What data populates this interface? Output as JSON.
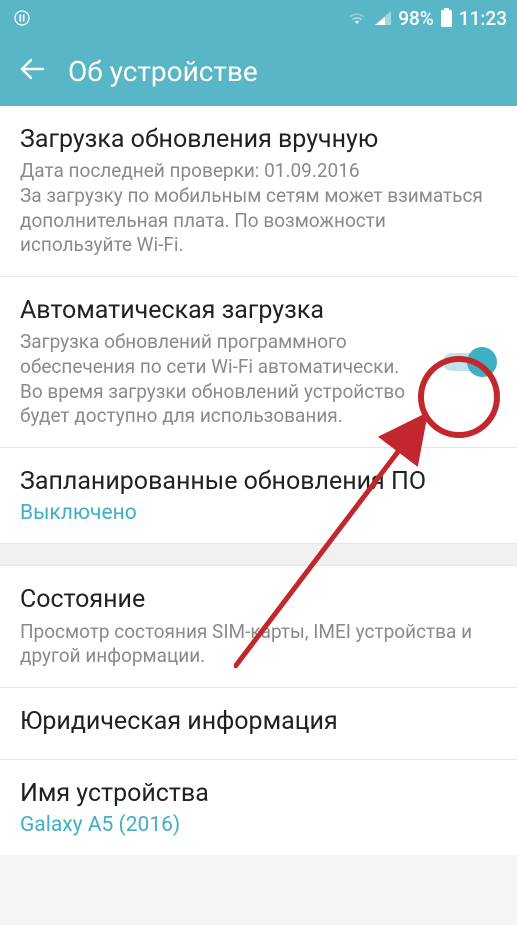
{
  "status": {
    "battery_pct": "98%",
    "time": "11:23"
  },
  "appbar": {
    "title": "Об устройстве"
  },
  "rows": {
    "manual_update": {
      "title": "Загрузка обновления вручную",
      "sub": "Дата последней проверки: 01.09.2016\nЗа загрузку по мобильным сетям может взиматься дополнительная плата. По возможности используйте Wi-Fi."
    },
    "auto_download": {
      "title": "Автоматическая загрузка",
      "sub": "Загрузка обновлений программного обеспечения по сети Wi-Fi автоматически. Во время загрузки обновлений устройство будет доступно для использования.",
      "toggle_on": true
    },
    "scheduled": {
      "title": "Запланированные обновления ПО",
      "value": "Выключено"
    },
    "status_row": {
      "title": "Состояние",
      "sub": "Просмотр состояния SIM-карты, IMEI устройства и другой информации."
    },
    "legal": {
      "title": "Юридическая информация"
    },
    "device_name": {
      "title": "Имя устройства",
      "value": "Galaxy A5 (2016)"
    }
  },
  "colors": {
    "accent": "#59b6c7",
    "link": "#3fb0c4",
    "annot": "#c1272d"
  }
}
